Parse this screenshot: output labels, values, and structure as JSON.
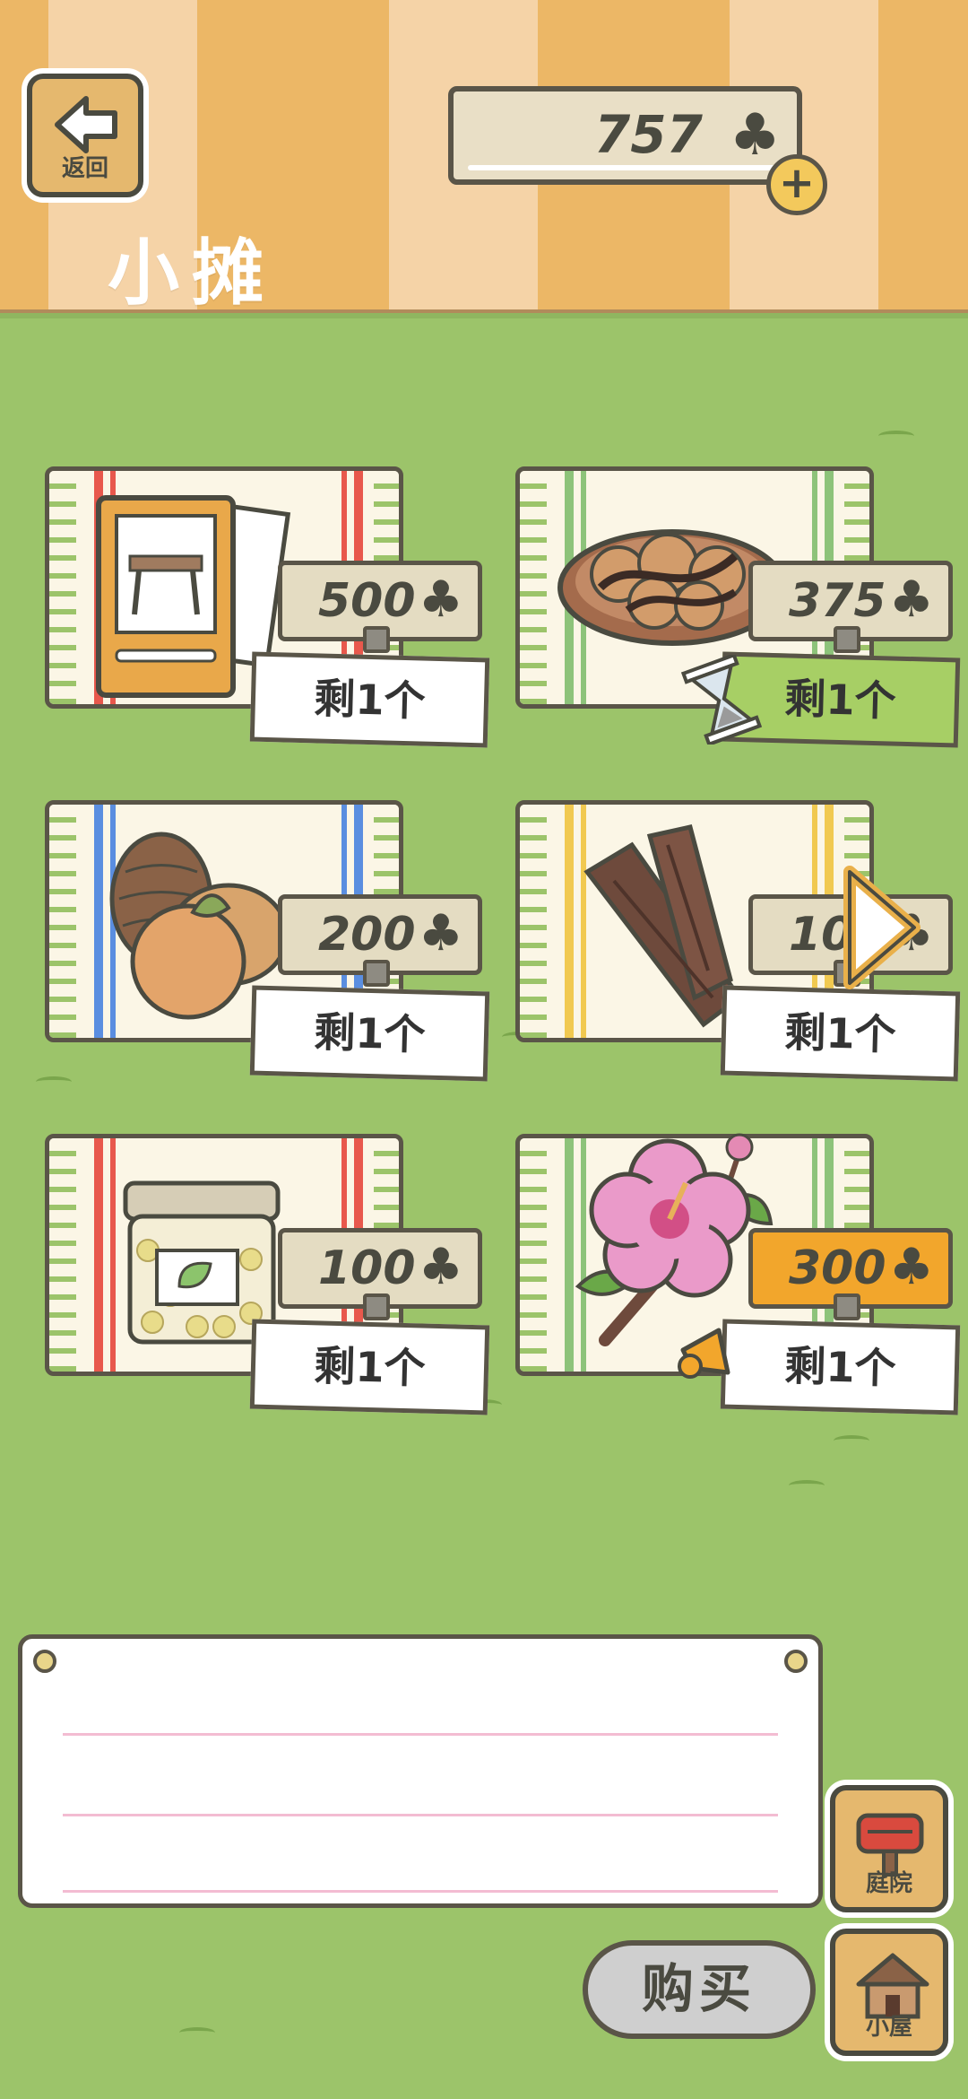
{
  "header": {
    "back_label": "返回",
    "title": "小摊",
    "currency_value": "757",
    "currency_symbol": "♣",
    "plus_symbol": "+"
  },
  "items": [
    {
      "name": "table-card",
      "price": "500",
      "stock": "剩1个"
    },
    {
      "name": "pancakes",
      "price": "375",
      "stock": "剩1个"
    },
    {
      "name": "pinecone-and-nut",
      "price": "200",
      "stock": "剩1个"
    },
    {
      "name": "dried-wood",
      "price": "10",
      "stock": "剩1个"
    },
    {
      "name": "jar-of-beans",
      "price": "100",
      "stock": "剩1个"
    },
    {
      "name": "hibiscus-flower",
      "price": "300",
      "stock": "剩1个"
    }
  ],
  "buy_label": "购买",
  "nav": {
    "garden_label": "庭院",
    "house_label": "小屋"
  },
  "colors": {
    "grass": "#9cc46a",
    "highlight_price": "#f2a62c",
    "sale_green": "#a7cf65"
  }
}
